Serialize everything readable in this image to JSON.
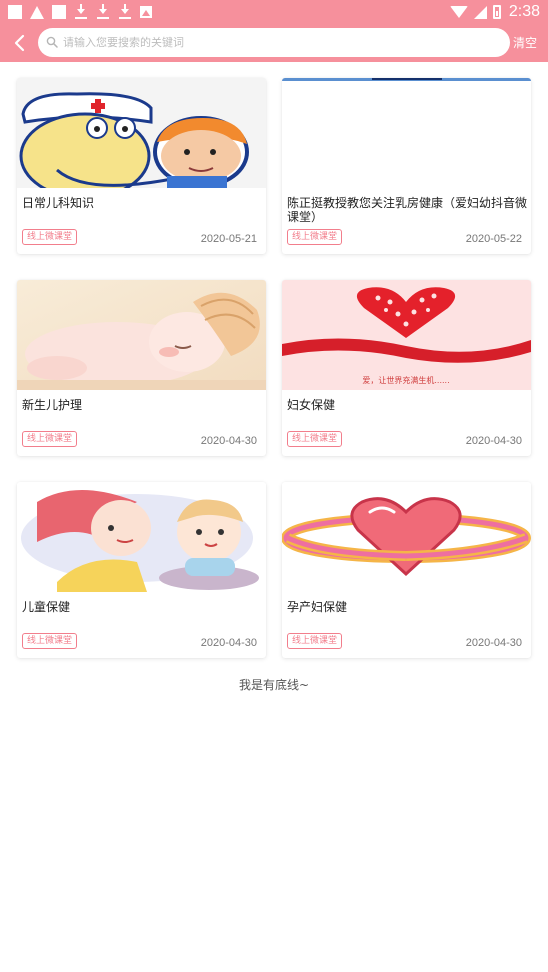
{
  "status_bar": {
    "time": "2:38",
    "icons": [
      "notification-square-icon",
      "warning-triangle-icon",
      "notification-square-icon",
      "download-icon",
      "download-icon",
      "download-icon",
      "image-icon",
      "wifi-icon",
      "signal-icon",
      "battery-icon"
    ]
  },
  "header": {
    "back_icon": "chevron-left-icon",
    "search_placeholder": "请输入您要搜索的关键词",
    "search_value": "",
    "clear_label": "清空",
    "accent_color": "#f6909c"
  },
  "cards": [
    {
      "title": "日常儿科知识",
      "tag": "线上微课堂",
      "date": "2020-05-21",
      "image": "cartoon-doctor-and-child"
    },
    {
      "title": "陈正挺教授教您关注乳房健康（爱妇幼抖音微课堂）",
      "tag": "线上微课堂",
      "date": "2020-05-22",
      "image": "blank-with-blue-top-border"
    },
    {
      "title": "新生儿护理",
      "tag": "线上微课堂",
      "date": "2020-04-30",
      "image": "sleeping-newborn"
    },
    {
      "title": "妇女保健",
      "tag": "线上微课堂",
      "date": "2020-04-30",
      "image": "red-hearts",
      "image_caption": "爱，让世界充满生机......"
    },
    {
      "title": "儿童保健",
      "tag": "线上微课堂",
      "date": "2020-04-30",
      "image": "mother-and-baby"
    },
    {
      "title": "孕产妇保健",
      "tag": "线上微课堂",
      "date": "2020-04-30",
      "image": "heart-planet-ring"
    }
  ],
  "footer_note": "我是有底线~",
  "colors": {
    "tag": "#f27e8c",
    "status_bar": "#f6909c",
    "background": "#ffffff"
  }
}
